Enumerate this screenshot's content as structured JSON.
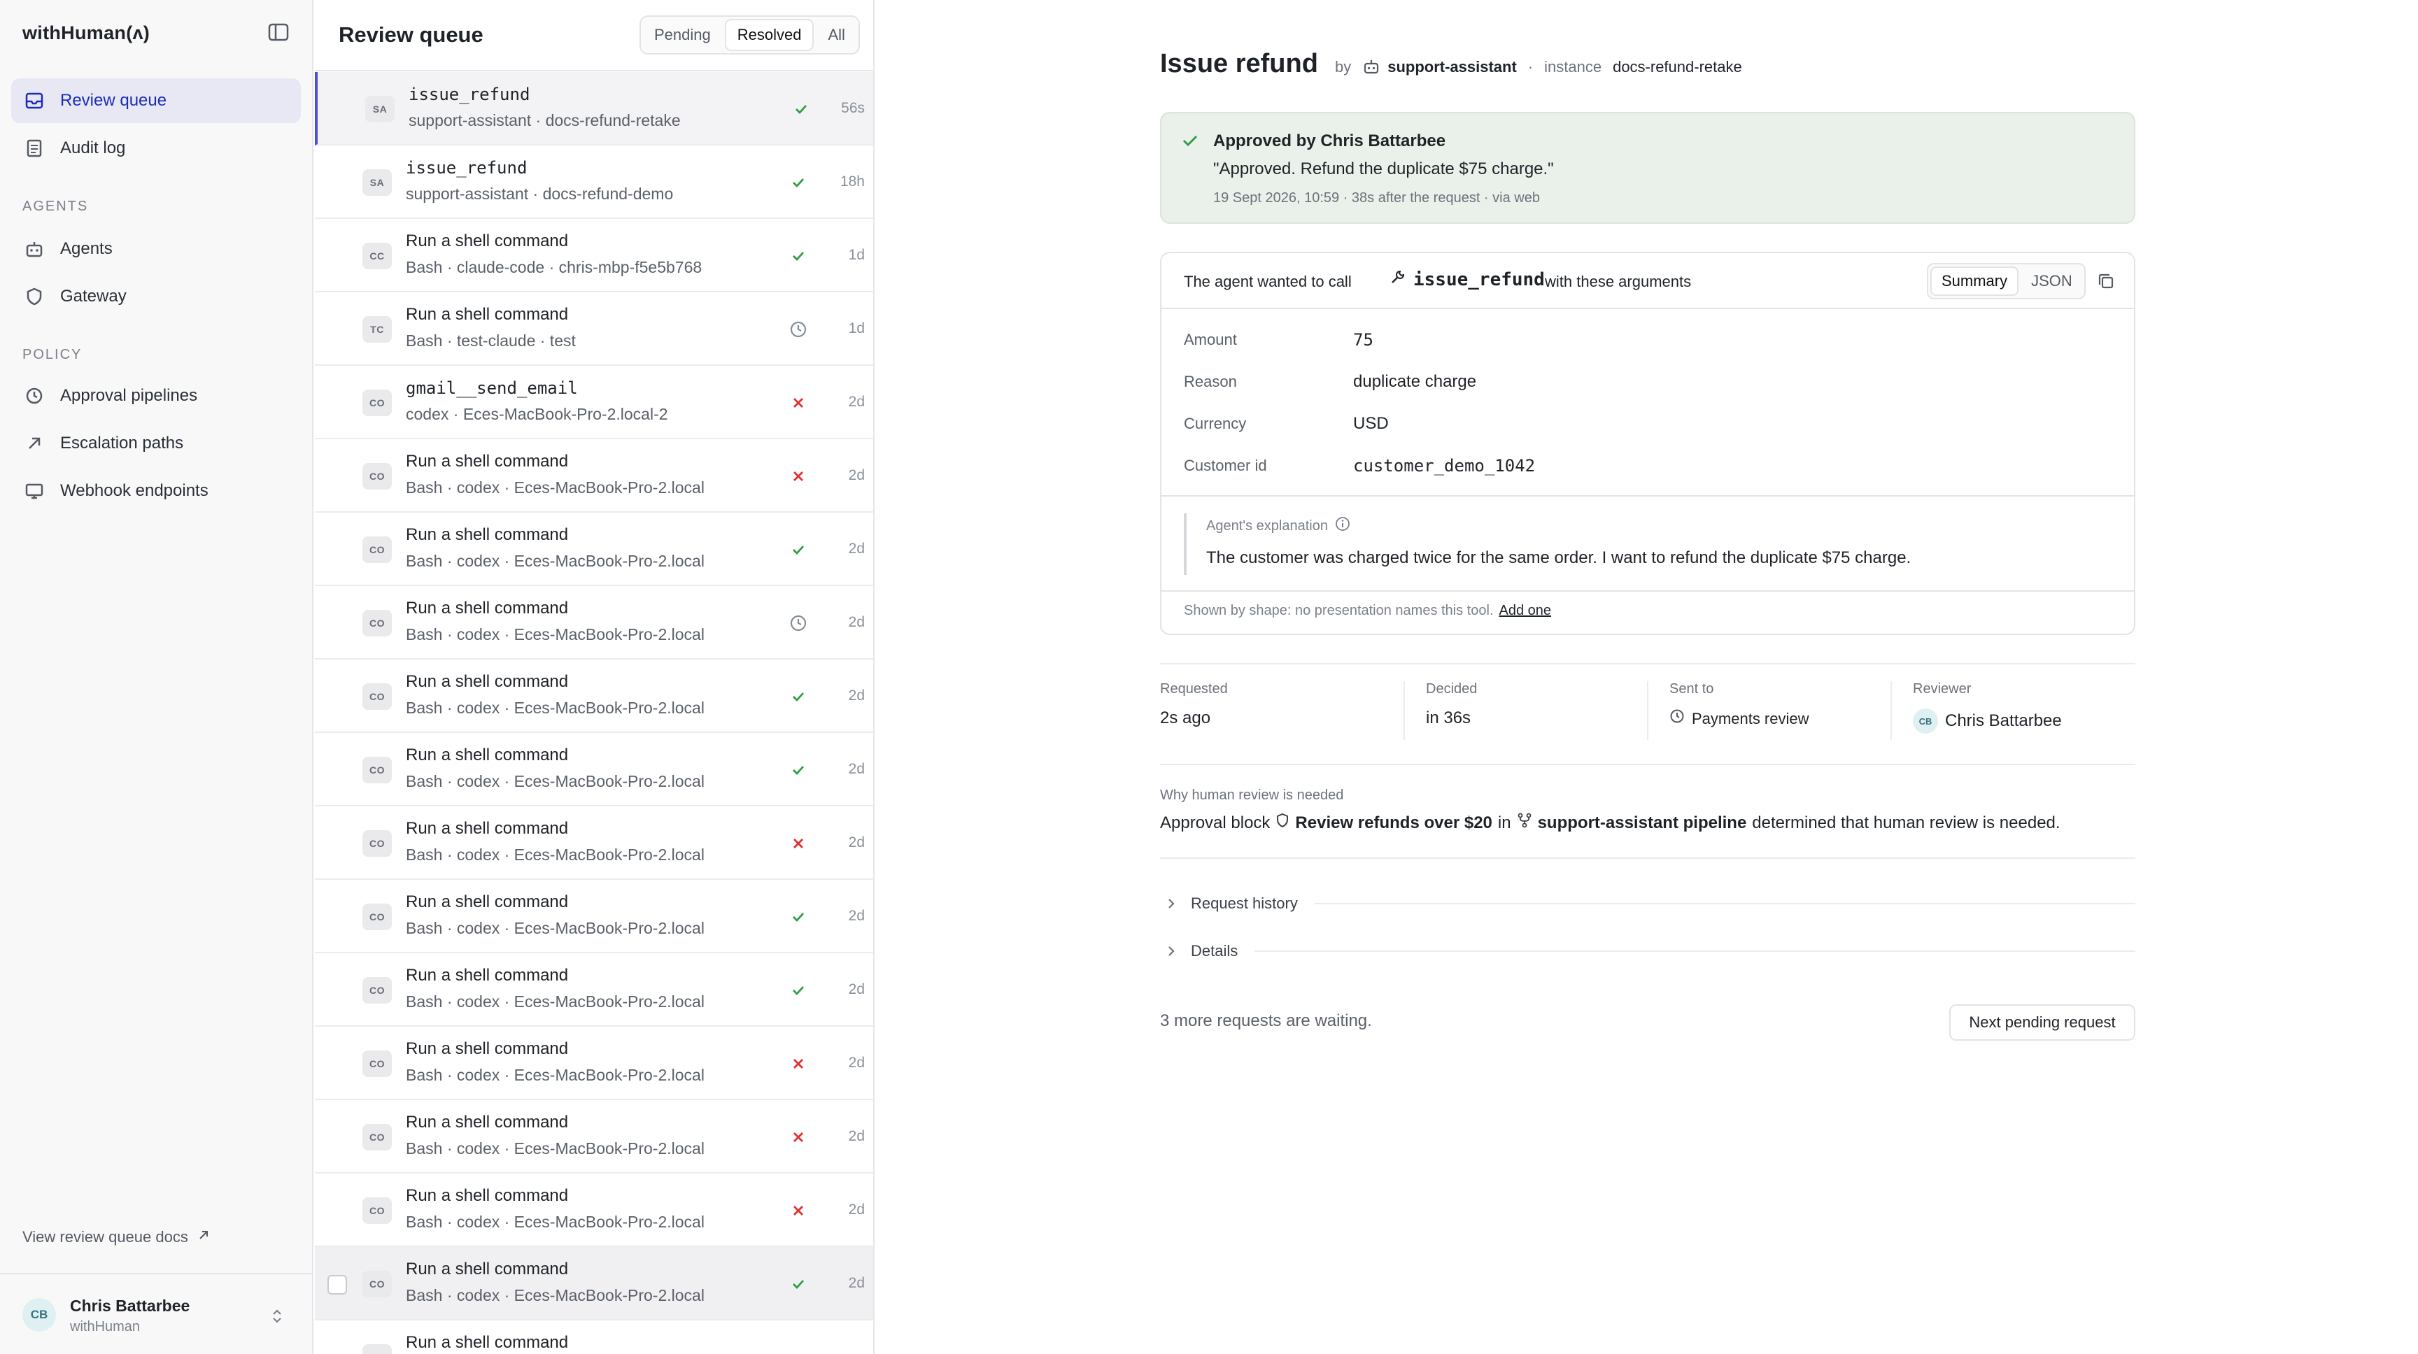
{
  "app": {
    "brand": "withHuman(ʌ)"
  },
  "sidebar": {
    "nav": [
      {
        "label": "Review queue",
        "icon": "inbox-icon",
        "active": true
      },
      {
        "label": "Audit log",
        "icon": "file-list-icon",
        "active": false
      }
    ],
    "sections": [
      {
        "title": "AGENTS",
        "items": [
          {
            "label": "Agents",
            "icon": "robot-icon"
          },
          {
            "label": "Gateway",
            "icon": "shield-icon"
          }
        ]
      },
      {
        "title": "POLICY",
        "items": [
          {
            "label": "Approval pipelines",
            "icon": "clock-circle-icon"
          },
          {
            "label": "Escalation paths",
            "icon": "arrow-up-right-icon"
          },
          {
            "label": "Webhook endpoints",
            "icon": "monitor-icon"
          }
        ]
      }
    ],
    "docs_link": "View review queue docs",
    "user": {
      "initials": "CB",
      "name": "Chris Battarbee",
      "org": "withHuman"
    }
  },
  "queue": {
    "title": "Review queue",
    "filters": [
      {
        "label": "Pending",
        "active": false
      },
      {
        "label": "Resolved",
        "active": true
      },
      {
        "label": "All",
        "active": false
      }
    ],
    "rows": [
      {
        "avatar": "SA",
        "title": "issue_refund",
        "mono": true,
        "sub": "support-assistant · docs-refund-retake",
        "status": "approved",
        "time": "56s",
        "selected": true
      },
      {
        "avatar": "SA",
        "title": "issue_refund",
        "mono": true,
        "sub": "support-assistant · docs-refund-demo",
        "status": "approved",
        "time": "18h"
      },
      {
        "avatar": "CC",
        "title": "Run a shell command",
        "sub": "Bash · claude-code · chris-mbp-f5e5b768",
        "status": "approved",
        "time": "1d"
      },
      {
        "avatar": "TC",
        "title": "Run a shell command",
        "sub": "Bash · test-claude · test",
        "status": "timeout",
        "time": "1d"
      },
      {
        "avatar": "CO",
        "title": "gmail__send_email",
        "mono": true,
        "sub": "codex · Eces-MacBook-Pro-2.local-2",
        "status": "denied",
        "time": "2d"
      },
      {
        "avatar": "CO",
        "title": "Run a shell command",
        "sub": "Bash · codex · Eces-MacBook-Pro-2.local",
        "status": "denied",
        "time": "2d"
      },
      {
        "avatar": "CO",
        "title": "Run a shell command",
        "sub": "Bash · codex · Eces-MacBook-Pro-2.local",
        "status": "approved",
        "time": "2d"
      },
      {
        "avatar": "CO",
        "title": "Run a shell command",
        "sub": "Bash · codex · Eces-MacBook-Pro-2.local",
        "status": "timeout",
        "time": "2d"
      },
      {
        "avatar": "CO",
        "title": "Run a shell command",
        "sub": "Bash · codex · Eces-MacBook-Pro-2.local",
        "status": "approved",
        "time": "2d"
      },
      {
        "avatar": "CO",
        "title": "Run a shell command",
        "sub": "Bash · codex · Eces-MacBook-Pro-2.local",
        "status": "approved",
        "time": "2d"
      },
      {
        "avatar": "CO",
        "title": "Run a shell command",
        "sub": "Bash · codex · Eces-MacBook-Pro-2.local",
        "status": "denied",
        "time": "2d"
      },
      {
        "avatar": "CO",
        "title": "Run a shell command",
        "sub": "Bash · codex · Eces-MacBook-Pro-2.local",
        "status": "approved",
        "time": "2d"
      },
      {
        "avatar": "CO",
        "title": "Run a shell command",
        "sub": "Bash · codex · Eces-MacBook-Pro-2.local",
        "status": "approved",
        "time": "2d"
      },
      {
        "avatar": "CO",
        "title": "Run a shell command",
        "sub": "Bash · codex · Eces-MacBook-Pro-2.local",
        "status": "denied",
        "time": "2d"
      },
      {
        "avatar": "CO",
        "title": "Run a shell command",
        "sub": "Bash · codex · Eces-MacBook-Pro-2.local",
        "status": "denied",
        "time": "2d"
      },
      {
        "avatar": "CO",
        "title": "Run a shell command",
        "sub": "Bash · codex · Eces-MacBook-Pro-2.local",
        "status": "denied",
        "time": "2d"
      },
      {
        "avatar": "CO",
        "title": "Run a shell command",
        "sub": "Bash · codex · Eces-MacBook-Pro-2.local",
        "status": "approved",
        "time": "2d",
        "highlight": true,
        "checkbox": true
      },
      {
        "avatar": "CO",
        "title": "Run a shell command",
        "sub": "",
        "status": "",
        "time": ""
      }
    ]
  },
  "detail": {
    "title": "Issue refund",
    "by_label": "by",
    "agent": "support-assistant",
    "instance_label": "instance",
    "instance": "docs-refund-retake",
    "approval": {
      "title": "Approved by Chris Battarbee",
      "quote": "\"Approved. Refund the duplicate $75 charge.\"",
      "meta": "19 Sept 2026, 10:59  ·  38s after the request  ·  via web"
    },
    "args": {
      "lead": "The agent wanted to call",
      "tool": "issue_refund",
      "trail": "with these arguments",
      "views": [
        {
          "label": "Summary",
          "active": true
        },
        {
          "label": "JSON",
          "active": false
        }
      ],
      "rows": [
        {
          "key": "Amount",
          "value": "75",
          "mono": true
        },
        {
          "key": "Reason",
          "value": "duplicate charge"
        },
        {
          "key": "Currency",
          "value": "USD"
        },
        {
          "key": "Customer id",
          "value": "customer_demo_1042",
          "mono": true
        }
      ],
      "explanation_label": "Agent's explanation",
      "explanation": "The customer was charged twice for the same order. I want to refund the duplicate $75 charge.",
      "shape_note": "Shown by shape: no presentation names this tool.",
      "shape_link": "Add one"
    },
    "meta": {
      "requested": {
        "label": "Requested",
        "value": "2s ago"
      },
      "decided": {
        "label": "Decided",
        "value": "in 36s"
      },
      "sent_to": {
        "label": "Sent to",
        "value": "Payments review"
      },
      "reviewer": {
        "label": "Reviewer",
        "initials": "CB",
        "value": "Chris Battarbee"
      }
    },
    "why": {
      "label": "Why human review is needed",
      "prefix": "Approval block",
      "block": "Review refunds over $20",
      "in": "in",
      "pipeline": "support-assistant pipeline",
      "suffix": "determined that human review is needed."
    },
    "disclosures": {
      "history": "Request history",
      "details": "Details"
    },
    "waiting": "3 more requests are waiting.",
    "next_button": "Next pending request"
  },
  "colors": {
    "accent": "#1d2bb8",
    "approved": "#2f9e44",
    "denied": "#e03131",
    "timeout": "#868e96"
  }
}
